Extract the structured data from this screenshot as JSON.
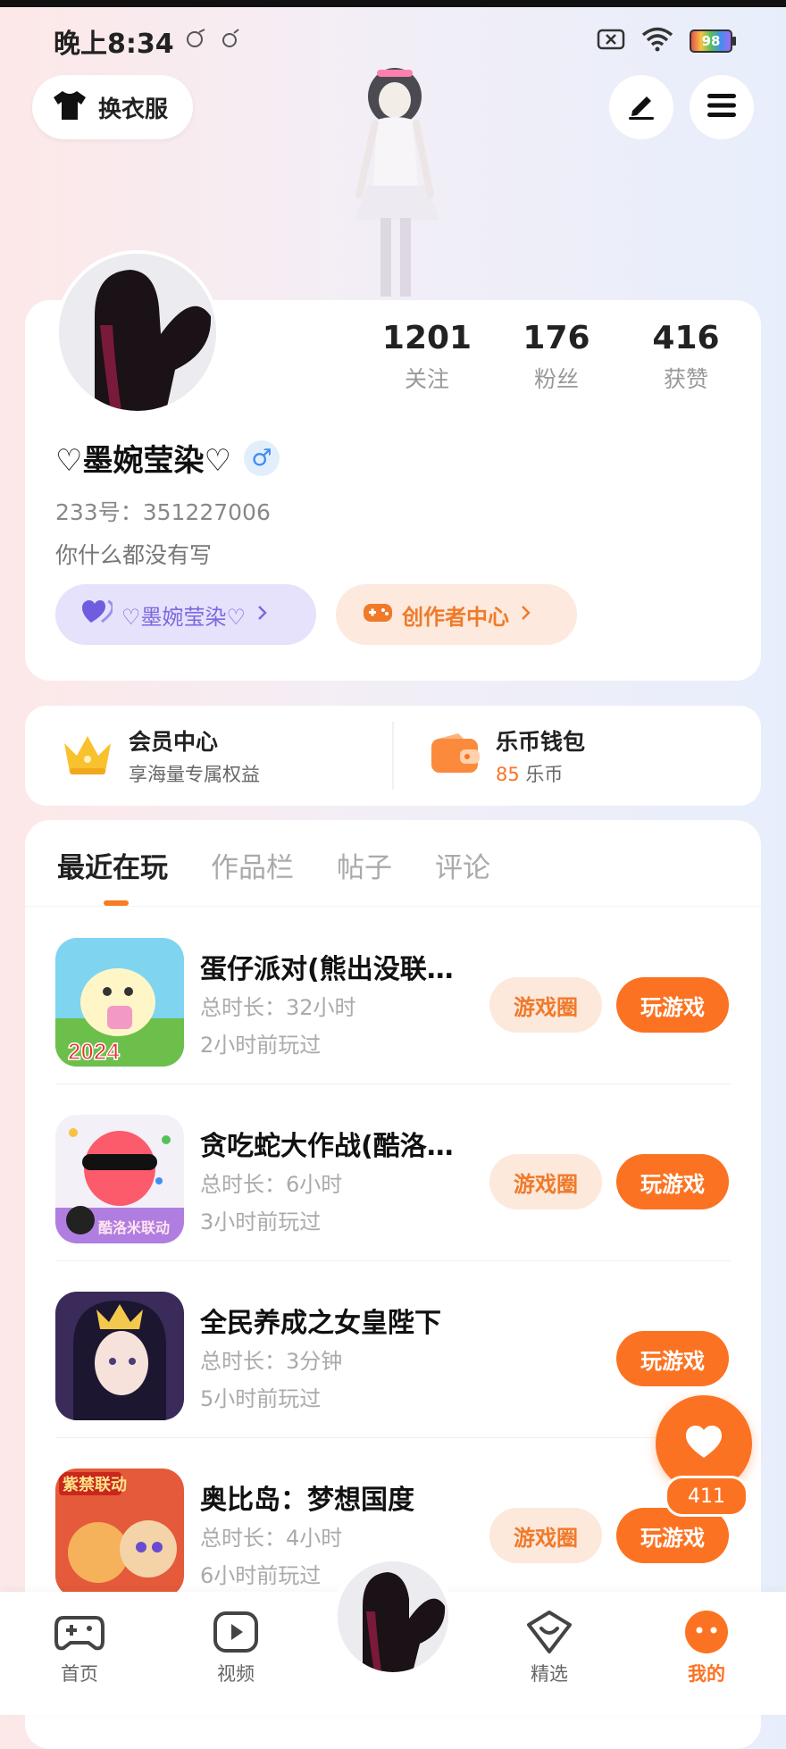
{
  "status_bar": {
    "time": "晚上8:34",
    "battery": "98"
  },
  "top_actions": {
    "dress_up_label": "换衣服"
  },
  "profile": {
    "stats": [
      {
        "value": "1201",
        "label": "关注"
      },
      {
        "value": "176",
        "label": "粉丝"
      },
      {
        "value": "416",
        "label": "获赞"
      }
    ],
    "nickname": "♡墨婉莹染♡",
    "gender_symbol": "♂",
    "uid": "233号：351227006",
    "bio": "你什么都没有写",
    "tag_label": "♡墨婉莹染♡",
    "creator_center_label": "创作者中心"
  },
  "member": {
    "title": "会员中心",
    "subtitle": "享海量专属权益"
  },
  "wallet": {
    "title": "乐币钱包",
    "amount": "85",
    "unit": "乐币"
  },
  "tabs": [
    "最近在玩",
    "作品栏",
    "帖子",
    "评论"
  ],
  "games": [
    {
      "title": "蛋仔派对(熊出没联…",
      "duration": "总时长：32小时",
      "last_played": "2小时前玩过",
      "circle_label": "游戏圈",
      "play_label": "玩游戏",
      "icon_text": "2024"
    },
    {
      "title": "贪吃蛇大作战(酷洛…",
      "duration": "总时长：6小时",
      "last_played": "3小时前玩过",
      "circle_label": "游戏圈",
      "play_label": "玩游戏",
      "icon_text": "酷洛米联动"
    },
    {
      "title": "全民养成之女皇陛下",
      "duration": "总时长：3分钟",
      "last_played": "5小时前玩过",
      "play_label": "玩游戏"
    },
    {
      "title": "奥比岛：梦想国度",
      "duration": "总时长：4小时",
      "last_played": "6小时前玩过",
      "circle_label": "游戏圈",
      "play_label": "玩游戏",
      "icon_text": "紫禁联动"
    }
  ],
  "like_count": "411",
  "bottom_nav": [
    {
      "label": "首页"
    },
    {
      "label": "视频"
    },
    {
      "label": "精选"
    },
    {
      "label": "我的"
    }
  ],
  "colors": {
    "accent": "#fb7322",
    "purple_tag": "#7b68e0"
  }
}
